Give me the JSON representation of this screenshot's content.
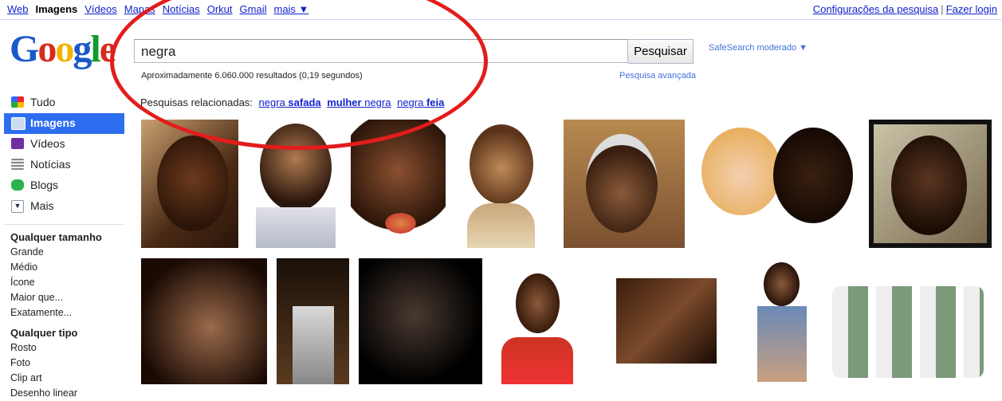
{
  "topnav": [
    "Web",
    "Imagens",
    "Vídeos",
    "Mapas",
    "Notícias",
    "Orkut",
    "Gmail",
    "mais ▼"
  ],
  "topright": {
    "settings": "Configurações da pesquisa",
    "login": "Fazer login",
    "sep": "|"
  },
  "logo": {
    "l1": "G",
    "l2": "o",
    "l3": "o",
    "l4": "g",
    "l5": "l",
    "l6": "e"
  },
  "search": {
    "value": "negra",
    "button": "Pesquisar",
    "safesearch": "SafeSearch moderado ▼",
    "stats": "Aproximadamente 6.060.000 resultados (0,19 segundos)",
    "advanced": "Pesquisa avançada"
  },
  "related": {
    "label": "Pesquisas relacionadas:",
    "r1a": "negra",
    "r1b": "safada",
    "r2a": "mulher",
    "r2b": "negra",
    "r3a": "negra",
    "r3b": "feia"
  },
  "sidebar": {
    "items": [
      "Tudo",
      "Imagens",
      "Vídeos",
      "Notícias",
      "Blogs",
      "Mais"
    ],
    "size_head": "Qualquer tamanho",
    "sizes": [
      "Grande",
      "Médio",
      "Ícone",
      "Maior que...",
      "Exatamente..."
    ],
    "type_head": "Qualquer tipo",
    "types": [
      "Rosto",
      "Foto",
      "Clip art",
      "Desenho linear"
    ]
  },
  "colors": {
    "accent": "#2d6ef0",
    "link": "#1122cc",
    "annotation": "#e31c1c"
  }
}
